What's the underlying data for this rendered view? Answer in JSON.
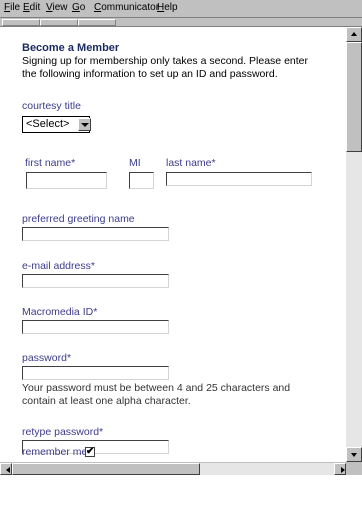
{
  "menu": [
    {
      "label": "File"
    },
    {
      "label": "Edit"
    },
    {
      "label": "View"
    },
    {
      "label": "Go"
    },
    {
      "label": "Communicator"
    },
    {
      "label": "Help"
    }
  ],
  "form": {
    "heading": "Become a Member",
    "intro_line1": "Signing up for membership only takes a second. Please enter",
    "intro_line2": "the following information to set up an ID and password.",
    "courtesy_title_label": "courtesy title",
    "courtesy_title_value": "<Select>",
    "first_name_label": "first name*",
    "mi_label": "MI",
    "last_name_label": "last name*",
    "greeting_label": "preferred greeting name",
    "email_label": "e-mail address*",
    "macromedia_id_label": "Macromedia ID*",
    "password_label": "password*",
    "password_note_line1": "Your password must be between 4 and 25 characters and",
    "password_note_line2": "contain at least one alpha character.",
    "retype_label": "retype password*",
    "remember_label": "remember me",
    "remember_checked": "✔"
  },
  "colors": {
    "heading": "#1a2a5e",
    "label": "#3c3c8c",
    "chrome": "#c0c0c0"
  },
  "icons": {
    "scroll_up": "triangle-up-icon",
    "scroll_down": "triangle-down-icon",
    "scroll_left": "triangle-left-icon",
    "scroll_right": "triangle-right-icon",
    "dropdown": "chevron-down-icon",
    "check": "checkmark-icon"
  }
}
